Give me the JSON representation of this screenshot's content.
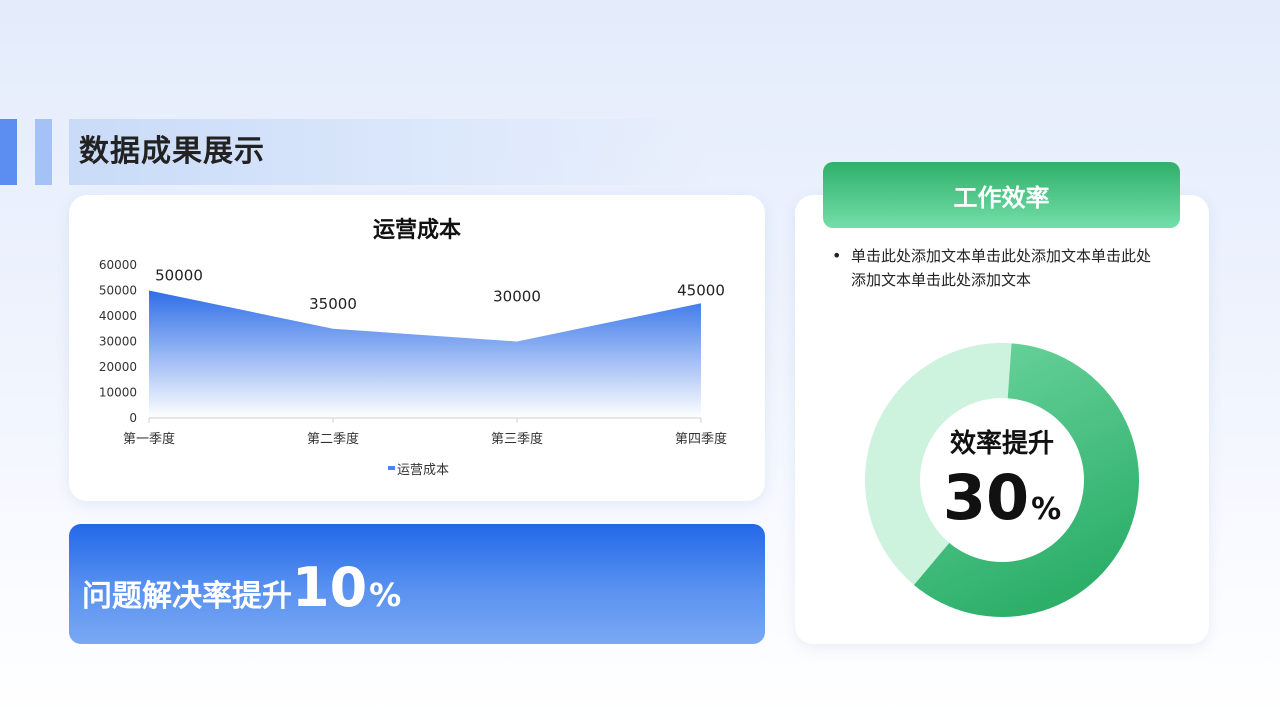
{
  "page": {
    "title": "数据成果展示"
  },
  "chart_data": {
    "type": "area",
    "title": "运营成本",
    "categories": [
      "第一季度",
      "第二季度",
      "第三季度",
      "第四季度"
    ],
    "series": [
      {
        "name": "运营成本",
        "values": [
          50000,
          35000,
          30000,
          45000
        ]
      }
    ],
    "data_labels": [
      "50000",
      "35000",
      "30000",
      "45000"
    ],
    "y_ticks": [
      "0",
      "10000",
      "20000",
      "30000",
      "40000",
      "50000",
      "60000"
    ],
    "ylim": [
      0,
      60000
    ],
    "grid": false,
    "legend_position": "bottom",
    "colors": {
      "fill_top": "#2f6ee8",
      "fill_bottom": "#ffffff",
      "legend": "#4a86ee"
    }
  },
  "banner": {
    "label": "问题解决率提升",
    "value": "10",
    "unit": "%"
  },
  "efficiency": {
    "header": "工作效率",
    "bullet": "单击此处添加文本单击此处添加文本单击此处添加文本单击此处添加文本",
    "donut_label": "效率提升",
    "donut_value": "30",
    "donut_unit": "%",
    "donut_fraction": 0.6,
    "colors": {
      "main_top": "#6fd6a0",
      "main_bottom": "#2daf6a",
      "rest": "#cdf2dd"
    }
  }
}
